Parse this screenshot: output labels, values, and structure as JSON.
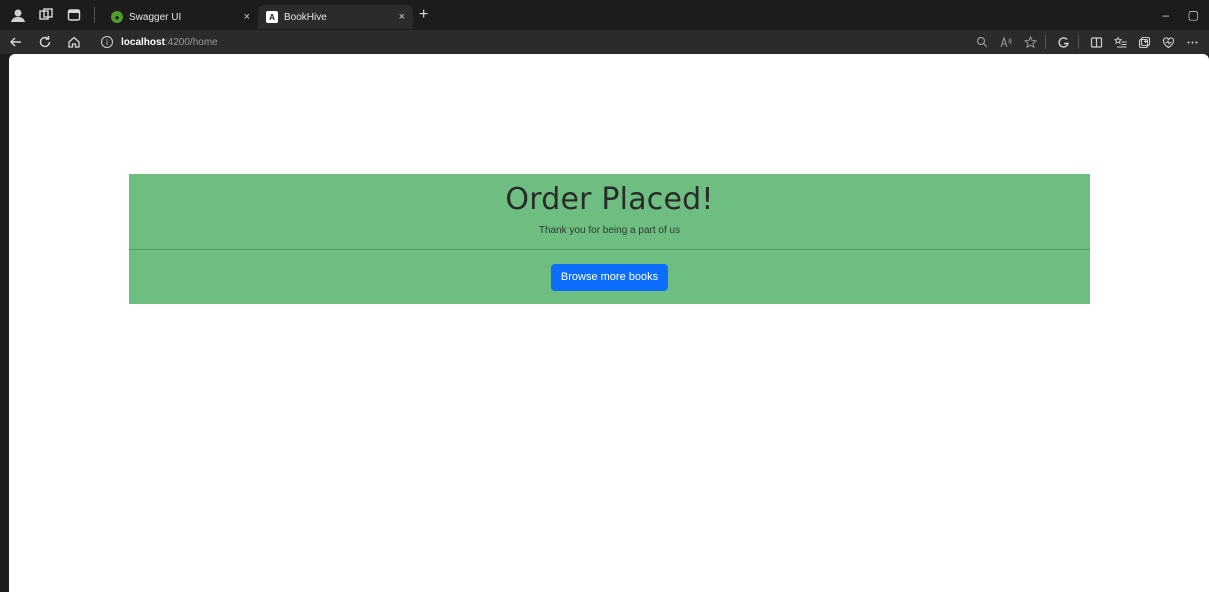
{
  "browser": {
    "tabs": [
      {
        "title": "Swagger UI",
        "icon": "swagger-icon",
        "active": false
      },
      {
        "title": "BookHive",
        "icon": "angular-icon",
        "active": true
      }
    ],
    "tab_close": "×",
    "new_tab": "+",
    "window_controls": {
      "minimize": "–",
      "restore": "▢"
    },
    "address": {
      "host": "localhost",
      "path": ":4200/home"
    }
  },
  "page": {
    "heading": "Order Placed!",
    "subtitle": "Thank you for being a part of us",
    "button_label": "Browse more books"
  },
  "colors": {
    "card_bg": "#6dbe80",
    "button_bg": "#0d6efd"
  }
}
